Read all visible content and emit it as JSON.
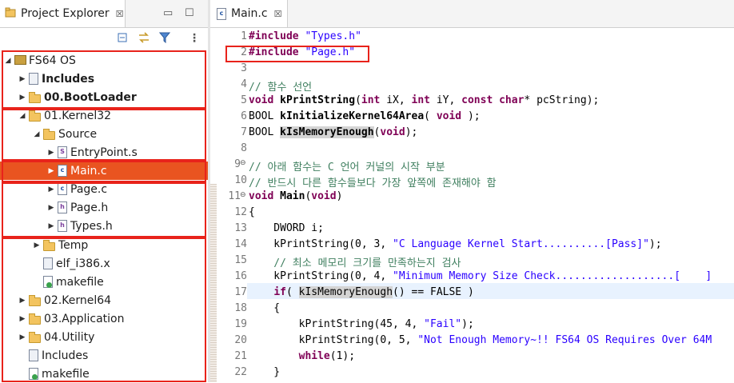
{
  "explorer": {
    "title": "Project Explorer",
    "close": "☒",
    "tree": [
      {
        "label": "FS64 OS",
        "icon": "project-icon",
        "expanded": true
      },
      {
        "label": "Includes",
        "icon": "includes-icon",
        "expanded": false
      },
      {
        "label": "00.BootLoader",
        "icon": "folder-icon",
        "expanded": false
      },
      {
        "label": "01.Kernel32",
        "icon": "folder-icon",
        "expanded": true
      },
      {
        "label": "Source",
        "icon": "folder-icon",
        "expanded": true
      },
      {
        "label": "EntryPoint.s",
        "icon": "asm-file-icon",
        "expanded": false
      },
      {
        "label": "Main.c",
        "icon": "c-file-icon",
        "expanded": false,
        "selected": true
      },
      {
        "label": "Page.c",
        "icon": "c-file-icon",
        "expanded": false
      },
      {
        "label": "Page.h",
        "icon": "h-file-icon",
        "expanded": false
      },
      {
        "label": "Types.h",
        "icon": "h-file-icon",
        "expanded": false
      },
      {
        "label": "Temp",
        "icon": "folder-icon",
        "expanded": false
      },
      {
        "label": "elf_i386.x",
        "icon": "text-file-icon"
      },
      {
        "label": "makefile",
        "icon": "makefile-icon"
      },
      {
        "label": "02.Kernel64",
        "icon": "folder-icon",
        "expanded": false
      },
      {
        "label": "03.Application",
        "icon": "folder-icon",
        "expanded": false
      },
      {
        "label": "04.Utility",
        "icon": "folder-icon",
        "expanded": false
      },
      {
        "label": "Includes",
        "icon": "text-file-icon"
      },
      {
        "label": "makefile",
        "icon": "makefile-icon"
      }
    ]
  },
  "editor": {
    "tab_label": "Main.c",
    "close": "☒",
    "line_numbers": [
      "1",
      "2",
      "3",
      "4",
      "5",
      "6",
      "7",
      "8",
      "9",
      "10",
      "11",
      "12",
      "13",
      "14",
      "15",
      "16",
      "17",
      "18",
      "19",
      "20",
      "21",
      "22"
    ],
    "code": {
      "l1_inc": "#include",
      "l1_str": "\"Types.h\"",
      "l2_inc": "#include",
      "l2_str": "\"Page.h\"",
      "l4": "// 함수 선언",
      "l5_void": "void",
      "l5_fn": "kPrintString",
      "l5_p1": "(",
      "l5_int1": "int",
      "l5_p2": " iX, ",
      "l5_int2": "int",
      "l5_p3": " iY, ",
      "l5_const": "const",
      "l5_char": "char",
      "l5_p4": "* pcString);",
      "l6_bool": "BOOL ",
      "l6_fn": "kInitializeKernel64Area",
      "l6_p1": "( ",
      "l6_void": "void",
      "l6_p2": " );",
      "l7_bool": "BOOL ",
      "l7_fn": "kIsMemoryEnough",
      "l7_p1": "(",
      "l7_void": "void",
      "l7_p2": ");",
      "l9": "// 아래 함수는 C 언어 커널의 시작 부분",
      "l10": "// 반드시 다른 함수들보다 가장 앞쪽에 존재해야 함",
      "l11_void": "void",
      "l11_fn": " Main",
      "l11_p1": "(",
      "l11_void2": "void",
      "l11_p2": ")",
      "l12": "{",
      "l13": "    DWORD i;",
      "l14_a": "    kPrintString(0, 3, ",
      "l14_s": "\"C Language Kernel Start..........[Pass]\"",
      "l14_b": ");",
      "l15": "    // 최소 메모리 크기를 만족하는지 검사",
      "l16_a": "    kPrintString(0, 4, ",
      "l16_s": "\"Minimum Memory Size Check...................[    ]",
      "l17_a": "    ",
      "l17_if": "if",
      "l17_b": "( ",
      "l17_fn": "kIsMemoryEnough",
      "l17_c": "() == FALSE )",
      "l18": "    {",
      "l19_a": "        kPrintString(45, 4, ",
      "l19_s": "\"Fail\"",
      "l19_b": ");",
      "l20_a": "        kPrintString(0, 5, ",
      "l20_s": "\"Not Enough Memory~!! FS64 OS Requires Over 64M",
      "l21_a": "        ",
      "l21_while": "while",
      "l21_b": "(1);",
      "l22": "    }"
    }
  }
}
